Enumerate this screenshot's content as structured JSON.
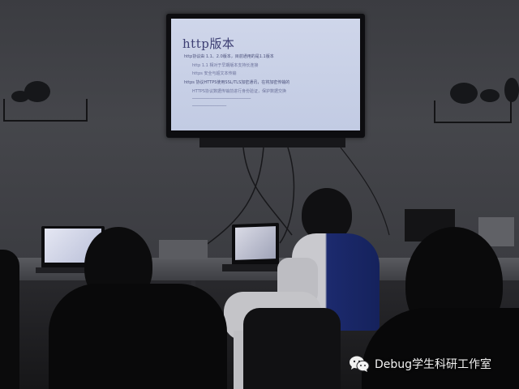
{
  "slide": {
    "title": "http版本",
    "bullets": [
      "http协议由 1.1、2.0版本，目前通用的是1.1版本",
      "http 1.1 相对于早期版本支持长连接",
      "https 安全与超文本传输",
      "https 协议HTTPS使用SSL/TLS加密通讯，在将加密传输的",
      "HTTPS协议数据传输前进行身份验证，保护数据交换"
    ]
  },
  "watermark": {
    "text": "Debug学生科研工作室",
    "icon": "wechat-icon"
  },
  "colors": {
    "slide_bg": "#c8d0e7",
    "slide_title": "#3d3f73",
    "wall": "#404146"
  }
}
